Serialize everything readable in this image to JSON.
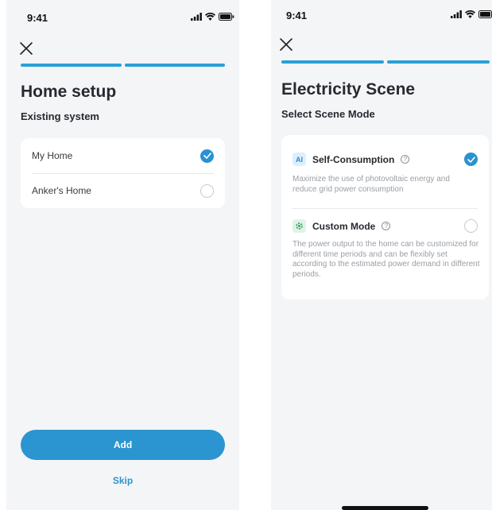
{
  "status": {
    "time": "9:41"
  },
  "home_setup": {
    "title": "Home setup",
    "subtitle": "Existing system",
    "homes": [
      {
        "label": "My Home",
        "selected": true
      },
      {
        "label": "Anker's Home",
        "selected": false
      }
    ],
    "add_label": "Add",
    "skip_label": "Skip"
  },
  "electricity_scene": {
    "title": "Electricity Scene",
    "subtitle": "Select Scene Mode",
    "modes": [
      {
        "badge": "AI",
        "title": "Self-Consumption",
        "selected": true,
        "description": "Maximize the use of photovoltaic energy and reduce grid power consumption"
      },
      {
        "title": "Custom Mode",
        "selected": false,
        "description": "The power output to the home can be customized for different time periods and can be flexibly set according to the estimated power demand in different periods."
      }
    ]
  },
  "colors": {
    "accent": "#2a95d0",
    "background": "#f4f5f7"
  },
  "icons": [
    "close-icon",
    "signal-icon",
    "wifi-icon",
    "battery-icon",
    "check-icon",
    "help-icon",
    "gear-icon"
  ]
}
